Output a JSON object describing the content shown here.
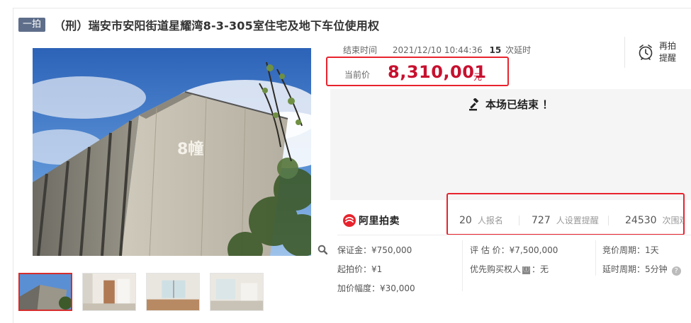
{
  "header": {
    "badge": "一拍",
    "title": "（刑）瑞安市安阳街道星耀湾8-3-305室住宅及地下车位使用权"
  },
  "gallery": {
    "main_image": "building-photo",
    "thumbnails": [
      "building-exterior",
      "room-doorway",
      "room-window",
      "room-empty"
    ],
    "active_thumbnail": 0,
    "building_sign": "8幢"
  },
  "auction": {
    "end_label": "结束时间",
    "end_time": "2021/12/10 10:44:36",
    "delay_count": "15",
    "delay_label": "次延时",
    "price_label": "当前价",
    "price_value": "8,310,001",
    "price_unit": "元",
    "ended_message": "本场已结束 ！",
    "remind_line1": "再拍",
    "remind_line2": "提醒"
  },
  "brand": {
    "logo_text": "阿里拍卖",
    "color": "#e8232d"
  },
  "stats": [
    {
      "num": "20",
      "label": "人报名"
    },
    {
      "num": "727",
      "label": "人设置提醒"
    },
    {
      "num": "24530",
      "label": "次围观"
    }
  ],
  "details": {
    "deposit_label": "保证金：",
    "deposit_value": "¥750,000",
    "start_label": "起拍价：",
    "start_value": "¥1",
    "increment_label": "加价幅度：",
    "increment_value": "¥30,000",
    "appraisal_label": "评 估 价：",
    "appraisal_value": "¥7,500,000",
    "priority_label": "优先购买权人",
    "priority_value": "：无",
    "cycle_label": "竞价周期：",
    "cycle_value": "1天",
    "delay_period_label": "延时周期：",
    "delay_period_value": "5分钟"
  },
  "colors": {
    "price": "#c8102e",
    "highlight_border": "#e8232d",
    "badge_bg": "#5e6e8a"
  }
}
